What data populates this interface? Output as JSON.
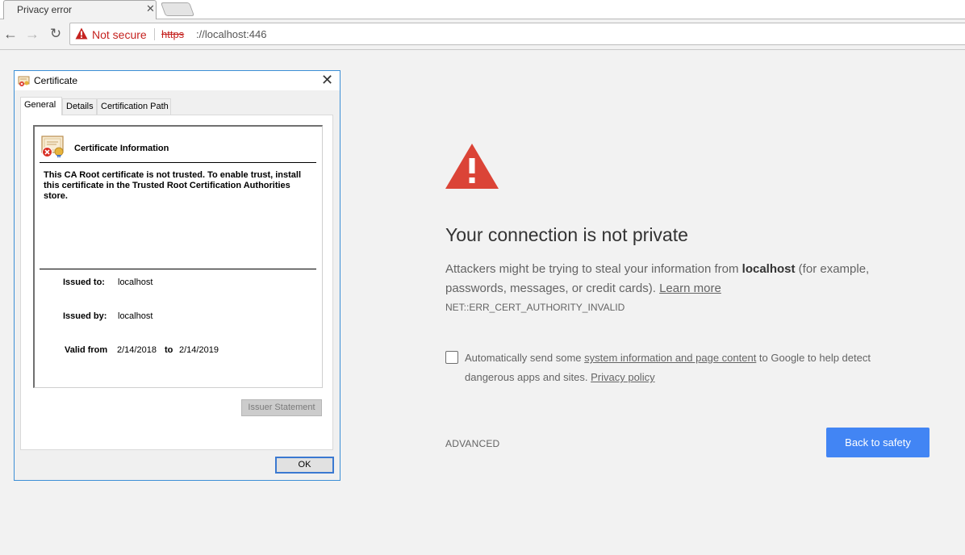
{
  "browser": {
    "tab": {
      "title": "Privacy error",
      "close_glyph": "✕"
    },
    "new_tab_icon": "new-tab-icon",
    "nav": {
      "back": "←",
      "forward": "→",
      "reload": "↻"
    },
    "omnibox": {
      "security_label": "Not secure",
      "url_scheme": "https",
      "url_rest": "://localhost:446"
    }
  },
  "interstitial": {
    "warning_icon": "warning-triangle-icon",
    "heading": "Your connection is not private",
    "explanation_before": "Attackers might be trying to steal your information from ",
    "host": "localhost",
    "explanation_after": " (for example, passwords, messages, or credit cards). ",
    "learn_more": "Learn more",
    "error_code": "NET::ERR_CERT_AUTHORITY_INVALID",
    "optin": {
      "checked": false,
      "text_before": "Automatically send some ",
      "link1": "system information and page content",
      "text_middle": " to Google to help detect dangerous apps and sites. ",
      "link2": "Privacy policy"
    },
    "advanced_label": "ADVANCED",
    "back_button": "Back to safety",
    "accent_color": "#4285f4",
    "warning_color": "#db4437"
  },
  "certificate_dialog": {
    "title": "Certificate",
    "close_glyph": "✕",
    "tabs": [
      {
        "label": "General",
        "active": true
      },
      {
        "label": "Details",
        "active": false
      },
      {
        "label": "Certification Path",
        "active": false
      }
    ],
    "info_title": "Certificate Information",
    "info_description": "This CA Root certificate is not trusted. To enable trust, install this certificate in the Trusted Root Certification Authorities store.",
    "issued_to_label": "Issued to:",
    "issued_to_value": "localhost",
    "issued_by_label": "Issued by:",
    "issued_by_value": "localhost",
    "valid_from_label": "Valid from",
    "valid_from_value": "2/14/2018",
    "valid_to_label": "to",
    "valid_to_value": "2/14/2019",
    "issuer_statement_button": "Issuer Statement",
    "ok_button": "OK"
  }
}
